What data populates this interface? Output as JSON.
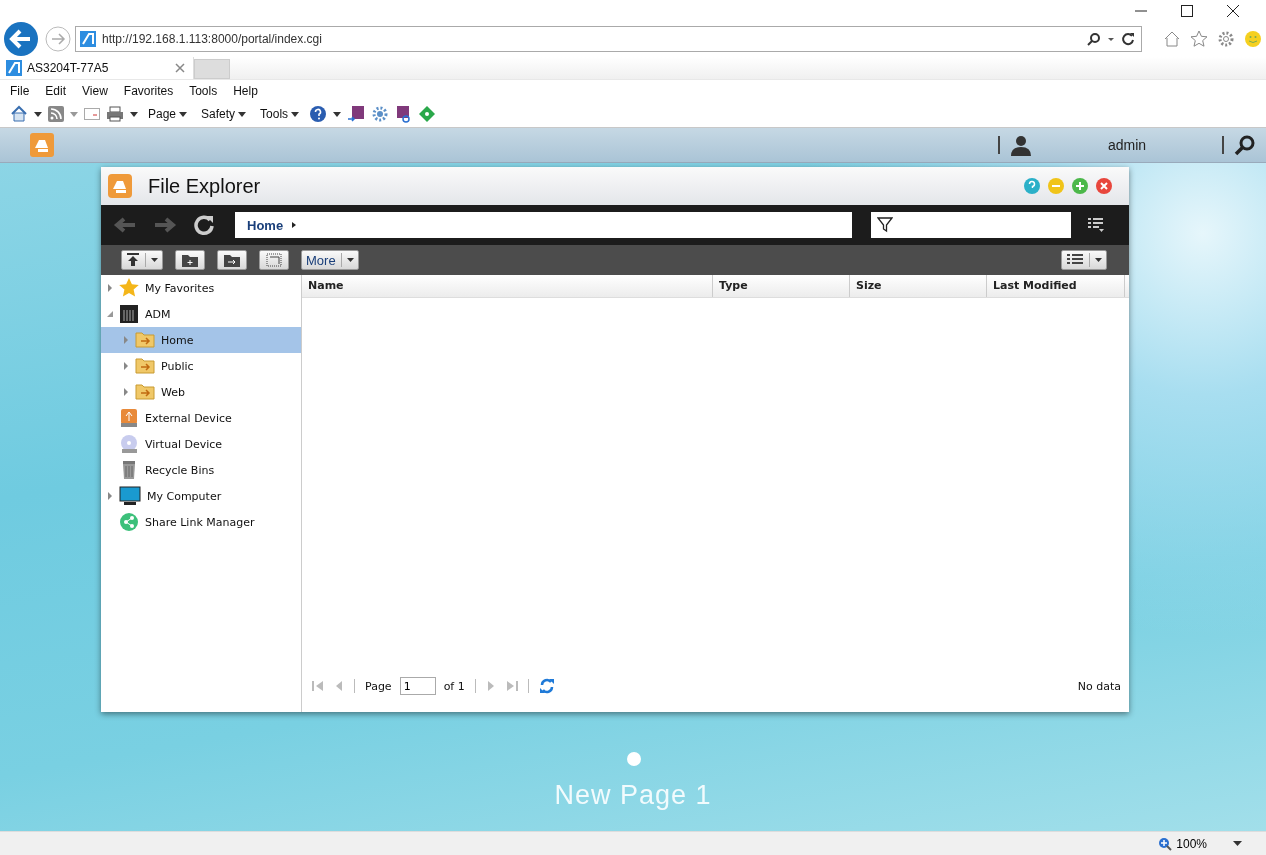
{
  "browser": {
    "url": "http://192.168.1.113:8000/portal/index.cgi",
    "tabs": [
      {
        "title": "AS3204T-77A5",
        "selected": true
      }
    ],
    "menu": [
      "File",
      "Edit",
      "View",
      "Favorites",
      "Tools",
      "Help"
    ],
    "command_bar": [
      "Page",
      "Safety",
      "Tools"
    ],
    "zoom": "100%"
  },
  "desktop": {
    "user": "admin",
    "page_title": "New Page 1",
    "page_dots": [
      {
        "selected": true
      }
    ]
  },
  "explorer": {
    "title": "File Explorer",
    "breadcrumb": "Home",
    "more_label": "More",
    "tree": [
      {
        "label": "My Favorites",
        "kind": "star",
        "expanded": false,
        "selected": false
      },
      {
        "label": "ADM",
        "kind": "nas",
        "expanded": true,
        "selected": false,
        "children": [
          {
            "label": "Home",
            "kind": "folder",
            "expanded": false,
            "selected": true
          },
          {
            "label": "Public",
            "kind": "folder",
            "expanded": false,
            "selected": false
          },
          {
            "label": "Web",
            "kind": "folder",
            "expanded": false,
            "selected": false
          }
        ]
      },
      {
        "label": "External Device",
        "kind": "usb",
        "selected": false
      },
      {
        "label": "Virtual Device",
        "kind": "disc",
        "selected": false
      },
      {
        "label": "Recycle Bins",
        "kind": "trash",
        "selected": false
      },
      {
        "label": "My Computer",
        "kind": "monitor",
        "expanded": false,
        "selected": false
      },
      {
        "label": "Share Link Manager",
        "kind": "share",
        "selected": false
      }
    ],
    "columns": [
      "Name",
      "Type",
      "Size",
      "Last Modified"
    ],
    "pager": {
      "page_label": "Page",
      "page_value": "1",
      "of_label": "of 1",
      "status": "No data"
    }
  }
}
